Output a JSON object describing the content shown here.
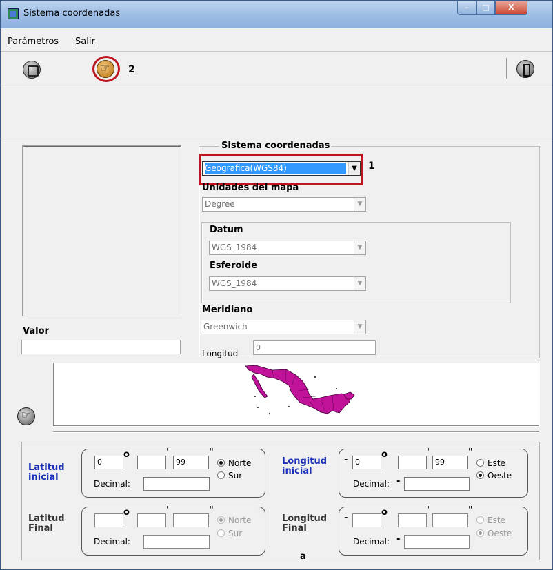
{
  "window": {
    "title": "Sistema coordenadas",
    "controls": {
      "minimize": "–",
      "maximize": "□",
      "close": "X"
    }
  },
  "menu": {
    "items": [
      "Parámetros",
      "Salir"
    ]
  },
  "toolbar": {
    "icons": [
      "save-icon",
      "hand-pointer-icon",
      "exit-door-icon"
    ],
    "annotation_label": "2"
  },
  "coord_system": {
    "group_title": "Sistema coordenadas",
    "selected": "Geografica(WGS84)",
    "annotation_label": "1",
    "units_label": "Unidades del mapa",
    "units_value": "Degree",
    "datum_label": "Datum",
    "datum_value": "WGS_1984",
    "spheroid_label": "Esferoide",
    "spheroid_value": "WGS_1984",
    "meridian_label": "Meridiano",
    "meridian_value": "Greenwich",
    "longitude_label": "Longitud",
    "longitude_value": "0"
  },
  "valor": {
    "label": "Valor",
    "value": ""
  },
  "coords": {
    "lat_ini": {
      "label_line1": "Latitud",
      "label_line2": "inicial",
      "deg": "0",
      "min": "",
      "sec": "99",
      "decimal_label": "Decimal:",
      "decimal_value": "",
      "opt1": "Norte",
      "opt2": "Sur",
      "selected": "Norte"
    },
    "lon_ini": {
      "label_line1": "Longitud",
      "label_line2": "inicial",
      "sign": "-",
      "deg": "0",
      "min": "",
      "sec": "99",
      "decimal_label": "Decimal:",
      "decimal_sign": "-",
      "decimal_value": "",
      "opt1": "Este",
      "opt2": "Oeste",
      "selected": "Oeste"
    },
    "lat_fin": {
      "label_line1": "Latitud",
      "label_line2": "Final",
      "deg": "",
      "min": "",
      "sec": "",
      "decimal_label": "Decimal:",
      "decimal_value": "",
      "opt1": "Norte",
      "opt2": "Sur"
    },
    "lon_fin": {
      "label_line1": "Longitud",
      "label_line2": "Final",
      "sign": "-",
      "deg": "",
      "min": "",
      "sec": "",
      "decimal_label": "Decimal:",
      "decimal_sign": "-",
      "decimal_value": "",
      "opt1": "Este",
      "opt2": "Oeste",
      "selected": "Oeste"
    },
    "degree_symbol": "o",
    "minute_symbol": "'",
    "second_symbol": "\"",
    "footer_label": "a"
  },
  "colors": {
    "annotation_red": "#c0141e",
    "map_fill": "#c0139a",
    "blue_label": "#1a2fb8",
    "selection": "#3399ff"
  }
}
